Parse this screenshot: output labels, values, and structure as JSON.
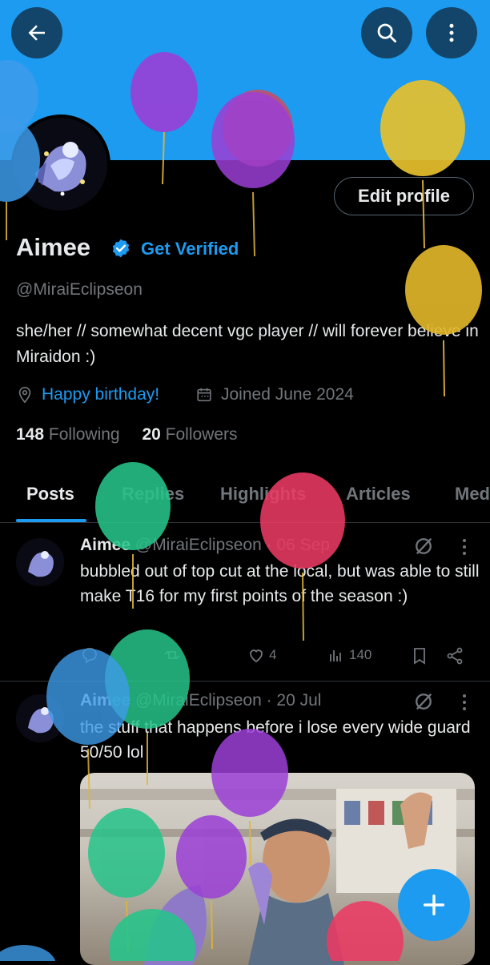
{
  "profile": {
    "name": "Aimee",
    "get_verified": "Get Verified",
    "handle": "@MiraiEclipseon",
    "bio": "she/her // somewhat decent vgc player // will forever believe in Miraidon :)",
    "location": "Happy birthday!",
    "joined": "Joined June 2024",
    "following_count": "148",
    "following_label": "Following",
    "followers_count": "20",
    "followers_label": "Followers",
    "edit_profile": "Edit profile"
  },
  "tabs": [
    "Posts",
    "Replies",
    "Highlights",
    "Articles",
    "Media"
  ],
  "posts": [
    {
      "name": "Aimee",
      "meta": "@MiraiEclipseon · 06 Sep",
      "text": "bubbled out of top cut at the local, but was able to still make T16 for my first points of the season :)",
      "likes": "4",
      "views": "140"
    },
    {
      "name": "Aimee",
      "meta": "@MiraiEclipseon · 20 Jul",
      "text": "the stuff that happens before i lose every wide guard 50/50 lol"
    }
  ],
  "colors": {
    "accent": "#1d9bf0",
    "background": "#000000",
    "muted": "#71767b"
  }
}
